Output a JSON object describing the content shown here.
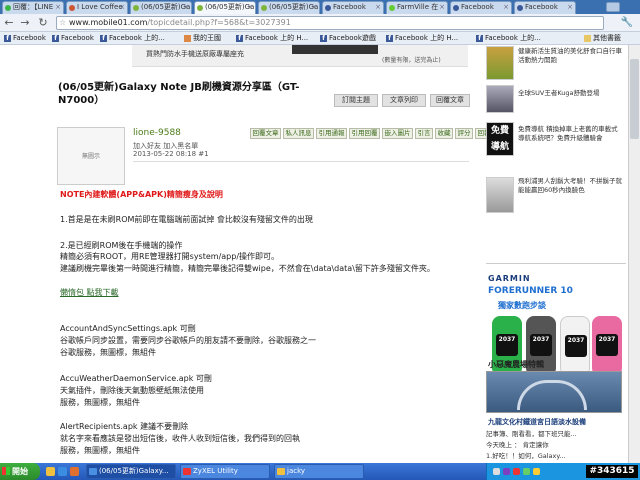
{
  "browser": {
    "tabs": [
      {
        "label": "回覆：【LINE"
      },
      {
        "label": "I Love Coffee"
      },
      {
        "label": "(06/05更新)Ga"
      },
      {
        "label": "(06/05更新)Ga"
      },
      {
        "label": "(06/05更新)Ga"
      },
      {
        "label": "Facebook"
      },
      {
        "label": "FarmVille 在"
      },
      {
        "label": "Facebook"
      },
      {
        "label": "Facebook"
      }
    ],
    "url_host": "www.mobile01.com",
    "url_path": "/topicdetail.php?f=568&t=3027391",
    "bookmarks": [
      {
        "label": "Facebook"
      },
      {
        "label": "Facebook"
      },
      {
        "label": "Facebook 上的..."
      },
      {
        "label": "我的王國"
      },
      {
        "label": "Facebook 上的 H..."
      },
      {
        "label": "Facebook遊戲"
      },
      {
        "label": "Facebook 上的 H..."
      },
      {
        "label": "Facebook 上的..."
      }
    ],
    "other_bookmarks": "其他書籤"
  },
  "page": {
    "banner_text_1": "買熱門防水手機送原廠專屬座充",
    "banner_text_2": "(數量有限，送完為止)",
    "post_title": "(06/05更新)Galaxy Note JB刷機資源分享區（GT-N7000）",
    "top_buttons": [
      "訂閱主題",
      "文章列印",
      "回覆文章"
    ],
    "avatar_placeholder": "無圖示",
    "username": "lione-9588",
    "user_links": "加入好友  加入黑名單",
    "post_date": "2013-05-22 08:18  #1",
    "action_buttons": [
      "回覆文章",
      "私人訊息",
      "引用通報",
      "引用回覆",
      "嵌入圖片",
      "引言",
      "收藏",
      "評分",
      "回報"
    ],
    "body": {
      "red_title": "NOTE內建軟體(APP&APK)精簡瘦身及說明",
      "line1": "1.首是是在未刷ROM前即在電腦端前面試掉 會比較沒有殘留文件的出現",
      "line2": "2.是已經刷ROM後在手機端的操作",
      "line3": "精簡必須有ROOT，用RE管理器打開system/app/操作即可。",
      "line4": "建議刷機完畢後第一時間進行精簡，精簡完畢後記得雙wipe，不然會在\\data\\data\\留下許多殘留文件夾。",
      "download": "懶惰包 點我下載",
      "app1_name": "AccountAndSyncSettings.apk 可刪",
      "app1_desc": "谷歌帳戶同步設置，需要同步谷歌帳戶的朋友請不要刪除，谷歌服務之一",
      "app1_desc2": "谷歌服務，無圖標，無組件",
      "app2_name": "AccuWeatherDaemonService.apk 可刪",
      "app2_desc": "天氣插件，刪除後天氣動態壁紙無法使用",
      "app2_desc2": "服務，無圖標，無組件",
      "app3_name": "AlertRecipients.apk 建議不要刪除",
      "app3_desc": "就名字來看應該是發出短信後，收件人收到短信後，我們得到的回執",
      "app3_desc2": "服務，無圖標，無組件"
    }
  },
  "sidebar": {
    "ads": [
      {
        "text": "健康新活生質油的美化舒食口自行車活動熱力開跑"
      },
      {
        "text": "全球SUV王者Kuga舒動登場"
      },
      {
        "text": "免費導航 積換掉車上老舊的車載式導航系統吧？免費升級體驗會"
      },
      {
        "text": "飛利浦男人刮鬍大考驗！不拼鬍子就能能贏回60秒內換臉色"
      }
    ],
    "free_nav": "免費導航",
    "garmin_logo": "GARMIN",
    "garmin_product": "FORERUNNER 10",
    "garmin_sub": "獨家數跑步談",
    "watch_time": "2037",
    "album_title": "小惡魔農場特輯",
    "album_caption": "九龍文化村鐵道宮日語淡水設備",
    "comments": [
      {
        "text": "記事簿、剛看看，都下班只能..."
      },
      {
        "text": "今天晚上 ： 肯定讓你"
      },
      {
        "text": "1.好吃！！如何，Galaxy..."
      }
    ]
  },
  "taskbar": {
    "start": "開始",
    "tasks": [
      {
        "label": "(06/05更新)Galaxy..."
      },
      {
        "label": "ZyXEL Utility"
      },
      {
        "label": "jacky"
      }
    ],
    "watermark": "#343615"
  },
  "colors": {
    "title_red": "#e01818",
    "username_green": "#4a7a1a",
    "link_green": "#2a6a2a",
    "taskbar_blue": "#2457b8",
    "garmin_blue": "#1f6fd0"
  }
}
